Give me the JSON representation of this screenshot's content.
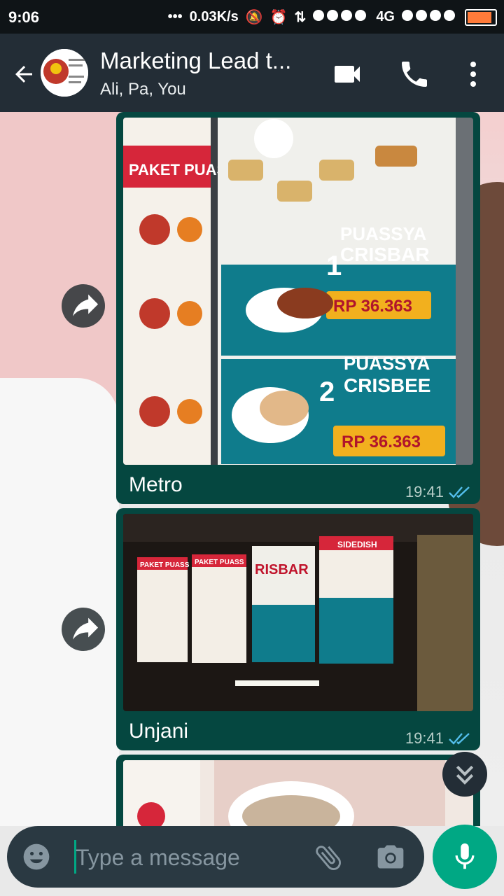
{
  "status": {
    "time": "9:06",
    "speed": "0.03K/s",
    "network": "4G",
    "battery_percent": 90
  },
  "header": {
    "title": "Marketing Lead t...",
    "subtitle": "Ali, Pa, You"
  },
  "messages": [
    {
      "caption": "Metro",
      "time": "19:41",
      "photo_texts": [
        "PAKET PUASS",
        "PUASSYA",
        "CRISBAR",
        "RP 36.363",
        "PUASSYA",
        "CRISBEE",
        "RP 36.363"
      ]
    },
    {
      "caption": "Unjani",
      "time": "19:41",
      "photo_texts": [
        "PAKET PUASS",
        "PAKET PUASS",
        "RISBAR",
        "SIDEDISH"
      ]
    }
  ],
  "input": {
    "placeholder": "Type a message"
  },
  "icons": {
    "back": "arrow-left-icon",
    "video": "video-call-icon",
    "call": "phone-icon",
    "menu": "more-vertical-icon",
    "emoji": "emoji-icon",
    "attach": "paperclip-icon",
    "camera": "camera-icon",
    "mic": "microphone-icon",
    "forward": "forward-icon",
    "scroll": "double-chevron-down-icon"
  },
  "colors": {
    "header": "#232d36",
    "bubble": "#054740",
    "accent": "#00a884",
    "read_ticks": "#53bdeb"
  }
}
